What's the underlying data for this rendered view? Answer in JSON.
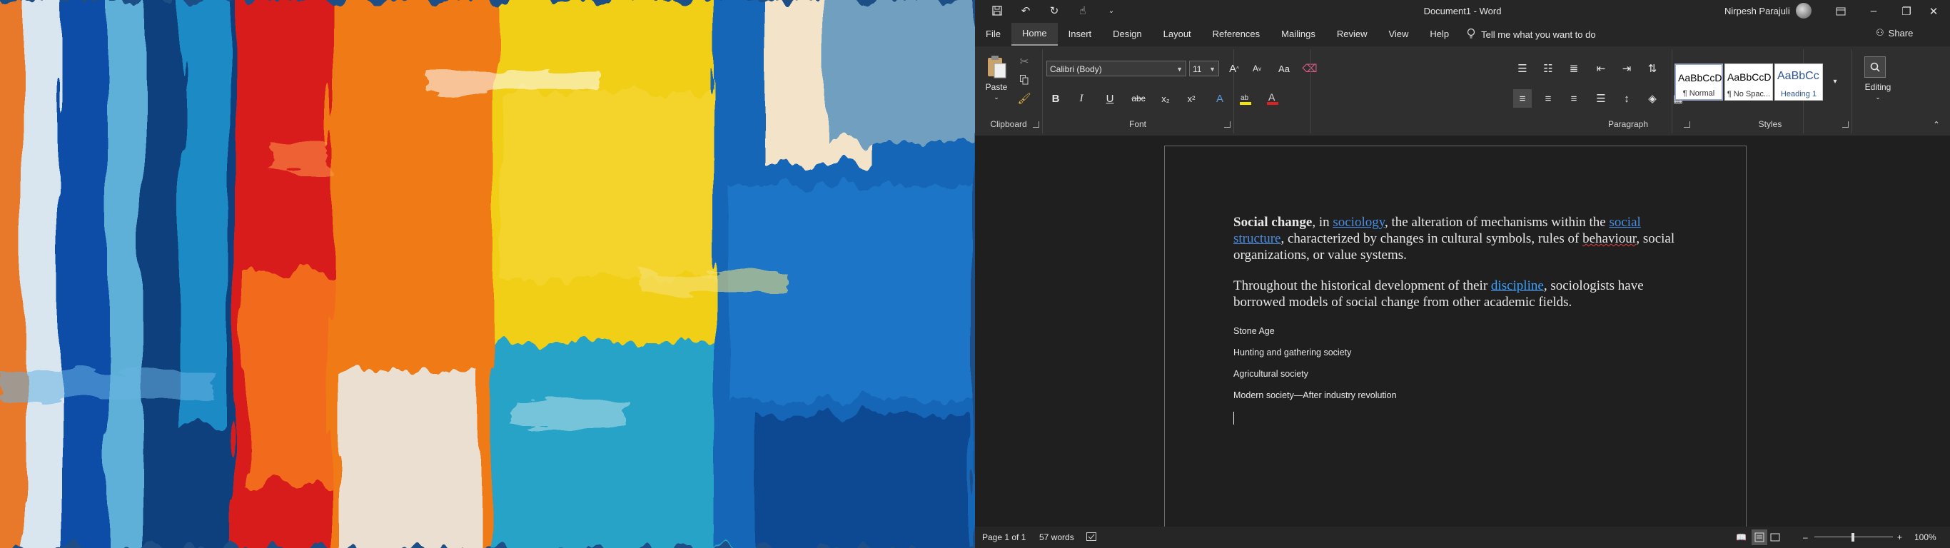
{
  "window": {
    "title": "Document1  -  Word",
    "user_name": "Nirpesh Parajuli"
  },
  "quick_access": {
    "icons": [
      "save-icon",
      "undo-icon",
      "redo-icon",
      "touch-mode-icon",
      "customize-qat-icon"
    ]
  },
  "ribbon_tabs": [
    "File",
    "Home",
    "Insert",
    "Design",
    "Layout",
    "References",
    "Mailings",
    "Review",
    "View",
    "Help"
  ],
  "active_tab": "Home",
  "tell_me": "Tell me what you want to do",
  "share": "Share",
  "ribbon": {
    "clipboard": {
      "label": "Clipboard",
      "paste": "Paste"
    },
    "font": {
      "label": "Font",
      "font_name": "Calibri (Body)",
      "font_size": "11",
      "bold": "B",
      "italic": "I",
      "underline": "U",
      "strike": "abc",
      "subscript": "x₂",
      "superscript": "x²",
      "case": "Aa",
      "grow": "A",
      "shrink": "A"
    },
    "paragraph": {
      "label": "Paragraph"
    },
    "styles": {
      "label": "Styles",
      "items": [
        {
          "sample": "AaBbCcDc",
          "name": "¶ Normal"
        },
        {
          "sample": "AaBbCcDc",
          "name": "¶ No Spac..."
        },
        {
          "sample": "AaBbCc",
          "name": "Heading 1"
        }
      ]
    },
    "editing": {
      "label": "Editing"
    }
  },
  "document": {
    "p1": {
      "bold_start": "Social change",
      "t1": ", in ",
      "link1": "sociology",
      "t2": ", the alteration of mechanisms within the ",
      "link2": "social structure",
      "t3": ", characterized by changes in cultural symbols, rules of ",
      "misspelled": "behaviour",
      "t4": ", social organizations, or value systems."
    },
    "p2": {
      "t1": "Throughout the historical development of their ",
      "link": "discipline",
      "t2": ", sociologists have borrowed models of social change from other academic fields."
    },
    "list": [
      "Stone Age",
      "Hunting and gathering society",
      "Agricultural society",
      "Modern society—After industry revolution"
    ]
  },
  "status": {
    "page": "Page 1 of 1",
    "words": "57 words",
    "zoom": "100%"
  }
}
